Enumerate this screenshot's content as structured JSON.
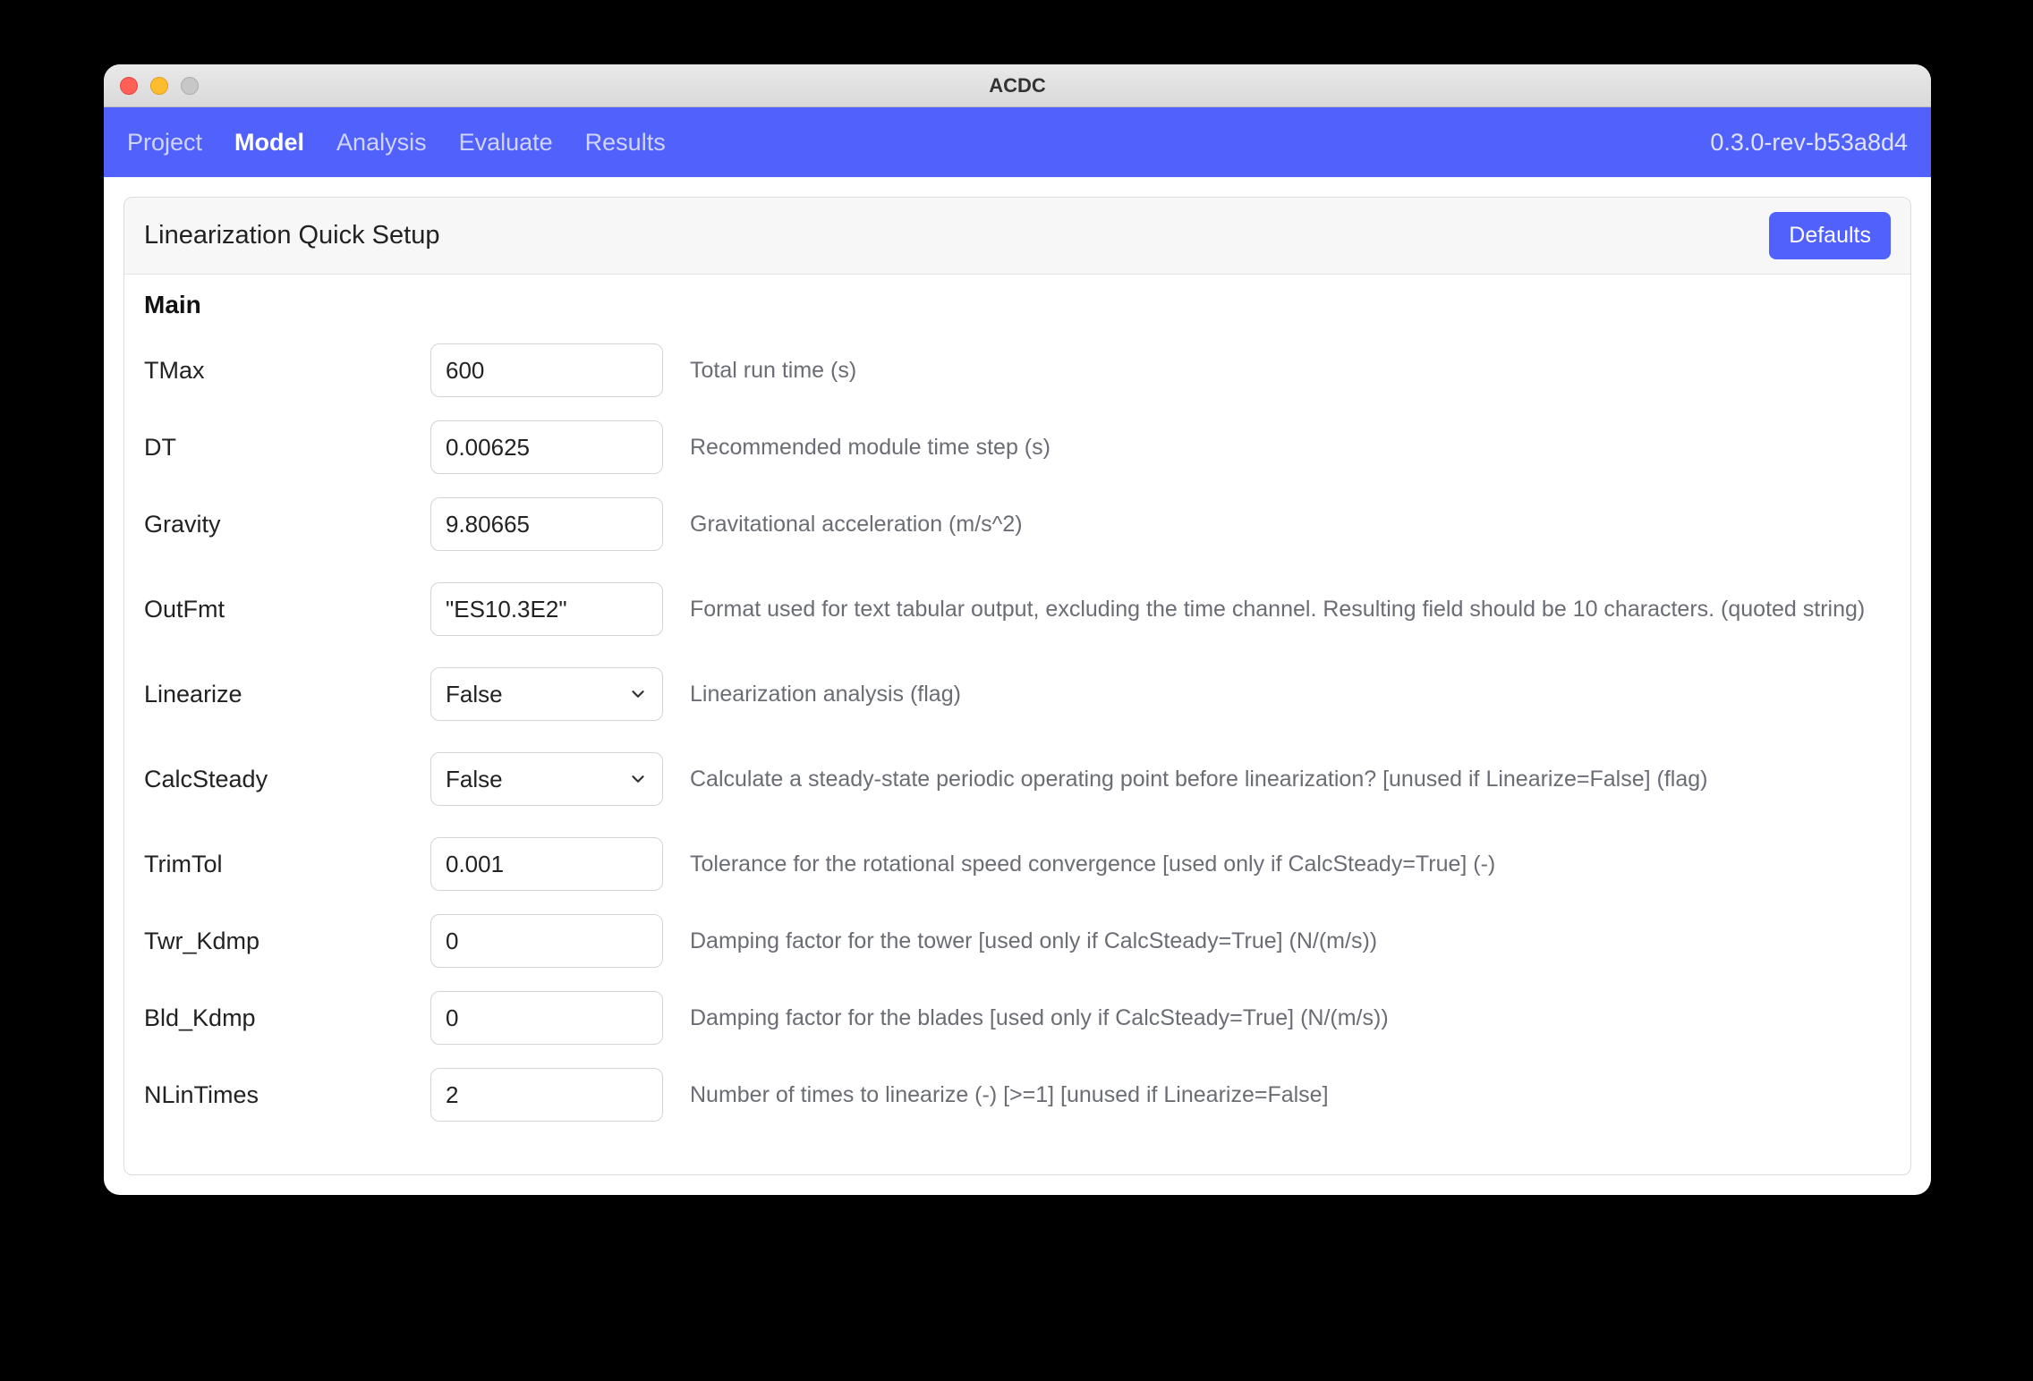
{
  "window": {
    "title": "ACDC"
  },
  "nav": {
    "items": [
      "Project",
      "Model",
      "Analysis",
      "Evaluate",
      "Results"
    ],
    "activeIndex": 1,
    "version": "0.3.0-rev-b53a8d4"
  },
  "card": {
    "title": "Linearization Quick Setup",
    "defaultsButton": "Defaults",
    "section": "Main"
  },
  "fields": [
    {
      "label": "TMax",
      "type": "text",
      "value": "600",
      "desc": "Total run time (s)"
    },
    {
      "label": "DT",
      "type": "text",
      "value": "0.00625",
      "desc": "Recommended module time step (s)"
    },
    {
      "label": "Gravity",
      "type": "text",
      "value": "9.80665",
      "desc": "Gravitational acceleration (m/s^2)"
    },
    {
      "label": "OutFmt",
      "type": "text",
      "value": "\"ES10.3E2\"",
      "desc": "Format used for text tabular output, excluding the time channel. Resulting field should be 10 characters. (quoted string)"
    },
    {
      "label": "Linearize",
      "type": "select",
      "value": "False",
      "desc": "Linearization analysis (flag)"
    },
    {
      "label": "CalcSteady",
      "type": "select",
      "value": "False",
      "desc": "Calculate a steady-state periodic operating point before linearization? [unused if Linearize=False] (flag)"
    },
    {
      "label": "TrimTol",
      "type": "text",
      "value": "0.001",
      "desc": "Tolerance for the rotational speed convergence [used only if CalcSteady=True] (-)"
    },
    {
      "label": "Twr_Kdmp",
      "type": "text",
      "value": "0",
      "desc": "Damping factor for the tower [used only if CalcSteady=True] (N/(m/s))"
    },
    {
      "label": "Bld_Kdmp",
      "type": "text",
      "value": "0",
      "desc": "Damping factor for the blades [used only if CalcSteady=True] (N/(m/s))"
    },
    {
      "label": "NLinTimes",
      "type": "text",
      "value": "2",
      "desc": "Number of times to linearize (-) [>=1] [unused if Linearize=False]"
    }
  ]
}
